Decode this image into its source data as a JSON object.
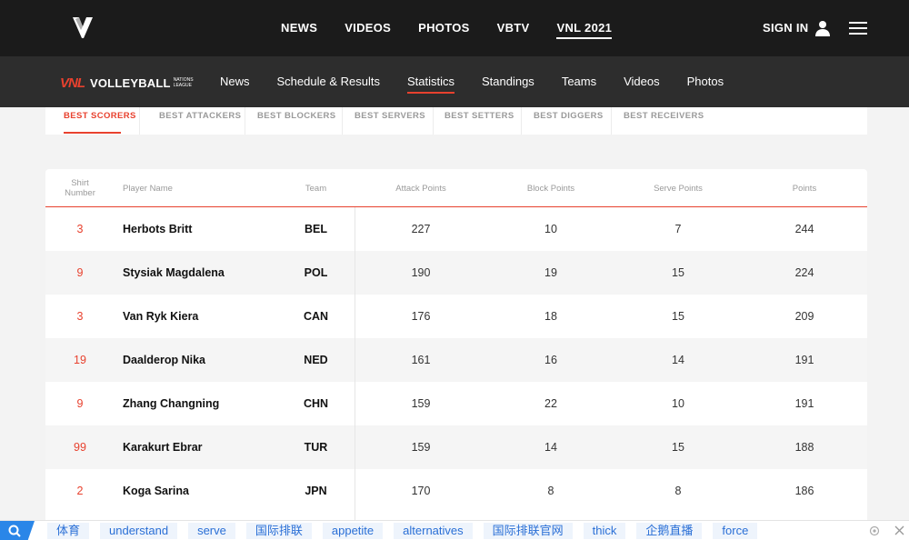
{
  "topbar": {
    "nav": [
      "NEWS",
      "VIDEOS",
      "PHOTOS",
      "VBTV",
      "VNL 2021"
    ],
    "active_index": 4,
    "signin": "SIGN IN"
  },
  "subnav": {
    "brand_mark": "VNL",
    "brand_word": "VOLLEYBALL",
    "brand_small": "NATIONS LEAGUE",
    "links": [
      "News",
      "Schedule & Results",
      "Statistics",
      "Standings",
      "Teams",
      "Videos",
      "Photos"
    ],
    "active_index": 2
  },
  "tabs": [
    "BEST SCORERS",
    "BEST ATTACKERS",
    "BEST BLOCKERS",
    "BEST SERVERS",
    "BEST SETTERS",
    "BEST DIGGERS",
    "BEST RECEIVERS"
  ],
  "table": {
    "headers": {
      "shirt_line1": "Shirt",
      "shirt_line2": "Number",
      "player": "Player Name",
      "team": "Team",
      "attack": "Attack Points",
      "block": "Block Points",
      "serve": "Serve Points",
      "points": "Points"
    },
    "rows": [
      {
        "shirt": "3",
        "name": "Herbots Britt",
        "team": "BEL",
        "attack": "227",
        "block": "10",
        "serve": "7",
        "points": "244"
      },
      {
        "shirt": "9",
        "name": "Stysiak Magdalena",
        "team": "POL",
        "attack": "190",
        "block": "19",
        "serve": "15",
        "points": "224"
      },
      {
        "shirt": "3",
        "name": "Van Ryk Kiera",
        "team": "CAN",
        "attack": "176",
        "block": "18",
        "serve": "15",
        "points": "209"
      },
      {
        "shirt": "19",
        "name": "Daalderop Nika",
        "team": "NED",
        "attack": "161",
        "block": "16",
        "serve": "14",
        "points": "191"
      },
      {
        "shirt": "9",
        "name": "Zhang Changning",
        "team": "CHN",
        "attack": "159",
        "block": "22",
        "serve": "10",
        "points": "191"
      },
      {
        "shirt": "99",
        "name": "Karakurt Ebrar",
        "team": "TUR",
        "attack": "159",
        "block": "14",
        "serve": "15",
        "points": "188"
      },
      {
        "shirt": "2",
        "name": "Koga Sarina",
        "team": "JPN",
        "attack": "170",
        "block": "8",
        "serve": "8",
        "points": "186"
      }
    ]
  },
  "suggestions": [
    "体育",
    "understand",
    "serve",
    "国际排联",
    "appetite",
    "alternatives",
    "国际排联官网",
    "thick",
    "企鹅直播",
    "force"
  ],
  "colors": {
    "accent": "#e8412e",
    "topbar": "#1b1b1b",
    "subnav": "#2d2d2d",
    "link": "#2a6fd6",
    "search": "#2a86e8"
  }
}
